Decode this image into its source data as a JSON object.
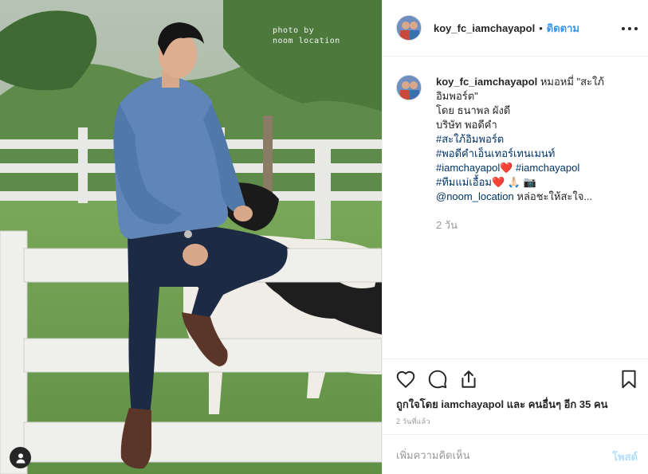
{
  "photo": {
    "watermark_line1": "photo by",
    "watermark_line2": "noom location",
    "user_tag_icon": "user-icon"
  },
  "header": {
    "username": "koy_fc_iamchayapol",
    "separator": "•",
    "follow_label": "ติดตาม",
    "more_icon": "more-options-icon"
  },
  "caption": {
    "username": "koy_fc_iamchayapol",
    "line1_text": "หมอหมี่ \"สะใภ้",
    "line2_text": "อิมพอร์ต\"",
    "line3_text": "โดย ธนาพล ผังดี",
    "line4_text": "บริษัท พอดีคำ",
    "hashtag1": "#สะใภ้อิมพอร์ต",
    "hashtag2": "#พอดีคำเอ็นเทอร์เทนเมนท์",
    "hashtag3": "#iamchayapol",
    "emoji_heart": "❤️",
    "hashtag4": "#iamchayapol",
    "hashtag5": "#ทีมแม่เอื้อม",
    "emoji_pray": "🙏🏻",
    "emoji_camera": "📷",
    "mention": "@noom_location",
    "mention_suffix": "หล่อชะให้สะใจ...",
    "time": "2 วัน"
  },
  "actions": {
    "like_icon": "heart-icon",
    "comment_icon": "comment-icon",
    "share_icon": "share-icon",
    "save_icon": "bookmark-icon"
  },
  "likes": {
    "prefix": "ถูกใจโดย",
    "name": "iamchayapol",
    "and": "และ",
    "others": "คนอื่นๆ อีก 35 คน"
  },
  "date": "2 วันที่แล้ว",
  "add_comment": {
    "placeholder": "เพิ่มความคิดเห็น",
    "post_label": "โพสต์"
  }
}
